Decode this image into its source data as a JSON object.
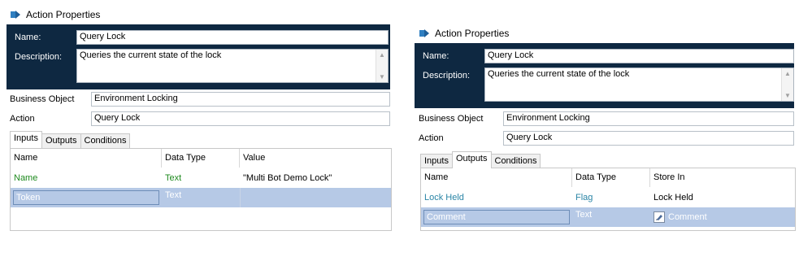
{
  "colors": {
    "header_bg": "#0e2841",
    "selected_row": "#b6c9e6",
    "green_text": "#1e8a1e",
    "teal_text": "#2a85a6"
  },
  "left": {
    "title": "Action Properties",
    "name_label": "Name:",
    "name_value": "Query Lock",
    "desc_label": "Description:",
    "desc_value": "Queries the current state of the lock",
    "bo_label": "Business Object",
    "bo_value": "Environment Locking",
    "action_label": "Action",
    "action_value": "Query Lock",
    "tabs": [
      "Inputs",
      "Outputs",
      "Conditions"
    ],
    "active_tab": "Inputs",
    "columns": [
      "Name",
      "Data Type",
      "Value"
    ],
    "rows": [
      {
        "name": "Name",
        "type": "Text",
        "value": "\"Multi Bot Demo Lock\""
      },
      {
        "name": "Token",
        "type": "Text",
        "value": ""
      }
    ]
  },
  "right": {
    "title": "Action Properties",
    "name_label": "Name:",
    "name_value": "Query Lock",
    "desc_label": "Description:",
    "desc_value": "Queries the current state of the lock",
    "bo_label": "Business Object",
    "bo_value": "Environment Locking",
    "action_label": "Action",
    "action_value": "Query Lock",
    "tabs": [
      "Inputs",
      "Outputs",
      "Conditions"
    ],
    "active_tab": "Outputs",
    "columns": [
      "Name",
      "Data Type",
      "Store In"
    ],
    "rows": [
      {
        "name": "Lock Held",
        "type": "Flag",
        "store": "Lock Held"
      },
      {
        "name": "Comment",
        "type": "Text",
        "store": "Comment"
      }
    ]
  }
}
